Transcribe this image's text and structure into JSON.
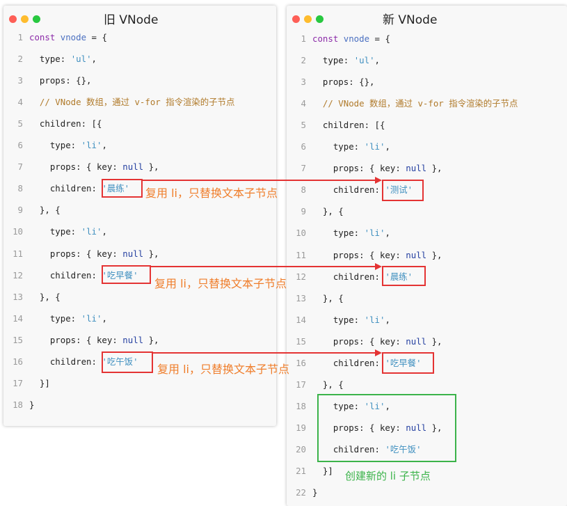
{
  "panels": {
    "old": {
      "title": "旧 VNode",
      "lines": [
        {
          "n": "1",
          "tokens": [
            {
              "t": "const ",
              "c": "kw"
            },
            {
              "t": "vnode",
              "c": "var"
            },
            {
              "t": " = {",
              "c": ""
            }
          ]
        },
        {
          "n": "2",
          "tokens": [
            {
              "t": "  type: ",
              "c": ""
            },
            {
              "t": "'ul'",
              "c": "str"
            },
            {
              "t": ",",
              "c": ""
            }
          ]
        },
        {
          "n": "3",
          "tokens": [
            {
              "t": "  props: {},",
              "c": ""
            }
          ]
        },
        {
          "n": "4",
          "tokens": [
            {
              "t": "  // VNode 数组，通过 v-for 指令渲染的子节点",
              "c": "cm"
            }
          ]
        },
        {
          "n": "5",
          "tokens": [
            {
              "t": "  children: [{",
              "c": ""
            }
          ]
        },
        {
          "n": "6",
          "tokens": [
            {
              "t": "    type: ",
              "c": ""
            },
            {
              "t": "'li'",
              "c": "str"
            },
            {
              "t": ",",
              "c": ""
            }
          ]
        },
        {
          "n": "7",
          "tokens": [
            {
              "t": "    props: { key: ",
              "c": ""
            },
            {
              "t": "null",
              "c": "nul"
            },
            {
              "t": " },",
              "c": ""
            }
          ]
        },
        {
          "n": "8",
          "tokens": [
            {
              "t": "    children: ",
              "c": ""
            },
            {
              "t": "'晨练'",
              "c": "str"
            }
          ]
        },
        {
          "n": "9",
          "tokens": [
            {
              "t": "  }, {",
              "c": ""
            }
          ]
        },
        {
          "n": "10",
          "tokens": [
            {
              "t": "    type: ",
              "c": ""
            },
            {
              "t": "'li'",
              "c": "str"
            },
            {
              "t": ",",
              "c": ""
            }
          ]
        },
        {
          "n": "11",
          "tokens": [
            {
              "t": "    props: { key: ",
              "c": ""
            },
            {
              "t": "null",
              "c": "nul"
            },
            {
              "t": " },",
              "c": ""
            }
          ]
        },
        {
          "n": "12",
          "tokens": [
            {
              "t": "    children: ",
              "c": ""
            },
            {
              "t": "'吃早餐'",
              "c": "str"
            }
          ]
        },
        {
          "n": "13",
          "tokens": [
            {
              "t": "  }, {",
              "c": ""
            }
          ]
        },
        {
          "n": "14",
          "tokens": [
            {
              "t": "    type: ",
              "c": ""
            },
            {
              "t": "'li'",
              "c": "str"
            },
            {
              "t": ",",
              "c": ""
            }
          ]
        },
        {
          "n": "15",
          "tokens": [
            {
              "t": "    props: { key: ",
              "c": ""
            },
            {
              "t": "null",
              "c": "nul"
            },
            {
              "t": " },",
              "c": ""
            }
          ]
        },
        {
          "n": "16",
          "tokens": [
            {
              "t": "    children: ",
              "c": ""
            },
            {
              "t": "'吃午饭'",
              "c": "str"
            }
          ]
        },
        {
          "n": "17",
          "tokens": [
            {
              "t": "  }]",
              "c": ""
            }
          ]
        },
        {
          "n": "18",
          "tokens": [
            {
              "t": "}",
              "c": ""
            }
          ]
        }
      ]
    },
    "new": {
      "title": "新 VNode",
      "lines": [
        {
          "n": "1",
          "tokens": [
            {
              "t": "const ",
              "c": "kw"
            },
            {
              "t": "vnode",
              "c": "var"
            },
            {
              "t": " = {",
              "c": ""
            }
          ]
        },
        {
          "n": "2",
          "tokens": [
            {
              "t": "  type: ",
              "c": ""
            },
            {
              "t": "'ul'",
              "c": "str"
            },
            {
              "t": ",",
              "c": ""
            }
          ]
        },
        {
          "n": "3",
          "tokens": [
            {
              "t": "  props: {},",
              "c": ""
            }
          ]
        },
        {
          "n": "4",
          "tokens": [
            {
              "t": "  // VNode 数组，通过 v-for 指令渲染的子节点",
              "c": "cm"
            }
          ]
        },
        {
          "n": "5",
          "tokens": [
            {
              "t": "  children: [{",
              "c": ""
            }
          ]
        },
        {
          "n": "6",
          "tokens": [
            {
              "t": "    type: ",
              "c": ""
            },
            {
              "t": "'li'",
              "c": "str"
            },
            {
              "t": ",",
              "c": ""
            }
          ]
        },
        {
          "n": "7",
          "tokens": [
            {
              "t": "    props: { key: ",
              "c": ""
            },
            {
              "t": "null",
              "c": "nul"
            },
            {
              "t": " },",
              "c": ""
            }
          ]
        },
        {
          "n": "8",
          "tokens": [
            {
              "t": "    children: ",
              "c": ""
            },
            {
              "t": "'测试'",
              "c": "str"
            }
          ]
        },
        {
          "n": "9",
          "tokens": [
            {
              "t": "  }, {",
              "c": ""
            }
          ]
        },
        {
          "n": "10",
          "tokens": [
            {
              "t": "    type: ",
              "c": ""
            },
            {
              "t": "'li'",
              "c": "str"
            },
            {
              "t": ",",
              "c": ""
            }
          ]
        },
        {
          "n": "11",
          "tokens": [
            {
              "t": "    props: { key: ",
              "c": ""
            },
            {
              "t": "null",
              "c": "nul"
            },
            {
              "t": " },",
              "c": ""
            }
          ]
        },
        {
          "n": "12",
          "tokens": [
            {
              "t": "    children: ",
              "c": ""
            },
            {
              "t": "'晨练'",
              "c": "str"
            }
          ]
        },
        {
          "n": "13",
          "tokens": [
            {
              "t": "  }, {",
              "c": ""
            }
          ]
        },
        {
          "n": "14",
          "tokens": [
            {
              "t": "    type: ",
              "c": ""
            },
            {
              "t": "'li'",
              "c": "str"
            },
            {
              "t": ",",
              "c": ""
            }
          ]
        },
        {
          "n": "15",
          "tokens": [
            {
              "t": "    props: { key: ",
              "c": ""
            },
            {
              "t": "null",
              "c": "nul"
            },
            {
              "t": " },",
              "c": ""
            }
          ]
        },
        {
          "n": "16",
          "tokens": [
            {
              "t": "    children: ",
              "c": ""
            },
            {
              "t": "'吃早餐'",
              "c": "str"
            }
          ]
        },
        {
          "n": "17",
          "tokens": [
            {
              "t": "  }, {",
              "c": ""
            }
          ]
        },
        {
          "n": "18",
          "tokens": [
            {
              "t": "    type: ",
              "c": ""
            },
            {
              "t": "'li'",
              "c": "str"
            },
            {
              "t": ",",
              "c": ""
            }
          ]
        },
        {
          "n": "19",
          "tokens": [
            {
              "t": "    props: { key: ",
              "c": ""
            },
            {
              "t": "null",
              "c": "nul"
            },
            {
              "t": " },",
              "c": ""
            }
          ]
        },
        {
          "n": "20",
          "tokens": [
            {
              "t": "    children: ",
              "c": ""
            },
            {
              "t": "'吃午饭'",
              "c": "str"
            }
          ]
        },
        {
          "n": "21",
          "tokens": [
            {
              "t": "  }]",
              "c": ""
            }
          ]
        },
        {
          "n": "22",
          "tokens": [
            {
              "t": "}",
              "c": ""
            }
          ]
        }
      ]
    }
  },
  "annotations": {
    "reuse_1": "复用 li，只替换文本子节点",
    "reuse_2": "复用 li，只替换文本子节点",
    "reuse_3": "复用 li，只替换文本子节点",
    "create_new": "创建新的 li 子节点"
  },
  "colors": {
    "highlight_box": "#e43333",
    "reuse_note": "#ef7d2a",
    "new_node": "#3bb34a"
  }
}
